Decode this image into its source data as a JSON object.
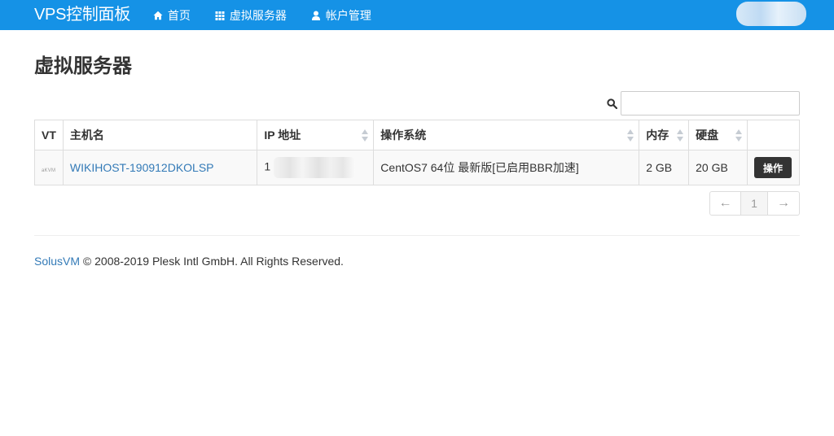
{
  "navbar": {
    "brand": "VPS控制面板",
    "items": [
      {
        "label": "首页",
        "icon": "home-icon"
      },
      {
        "label": "虚拟服务器",
        "icon": "grid-icon"
      },
      {
        "label": "帐户管理",
        "icon": "user-icon"
      }
    ],
    "color": "#1592e6"
  },
  "main": {
    "title": "虚拟服务器",
    "search": {
      "value": "",
      "placeholder": ""
    }
  },
  "table": {
    "columns": [
      "VT",
      "主机名",
      "IP 地址",
      "操作系统",
      "内存",
      "硬盘",
      ""
    ],
    "rows": [
      {
        "vt_logo_prefix": "a",
        "vt_logo_text": "KVM",
        "hostname": "WIKIHOST-190912DKOLSP",
        "ip_visible": "1",
        "os": "CentOS7 64位 最新版[已启用BBR加速]",
        "memory": "2 GB",
        "disk": "20 GB",
        "action_label": "操作"
      }
    ]
  },
  "pagination": {
    "prev": "←",
    "current": "1",
    "next": "→"
  },
  "footer": {
    "link": "SolusVM",
    "text": " © 2008-2019 Plesk Intl GmbH. All Rights Reserved."
  }
}
